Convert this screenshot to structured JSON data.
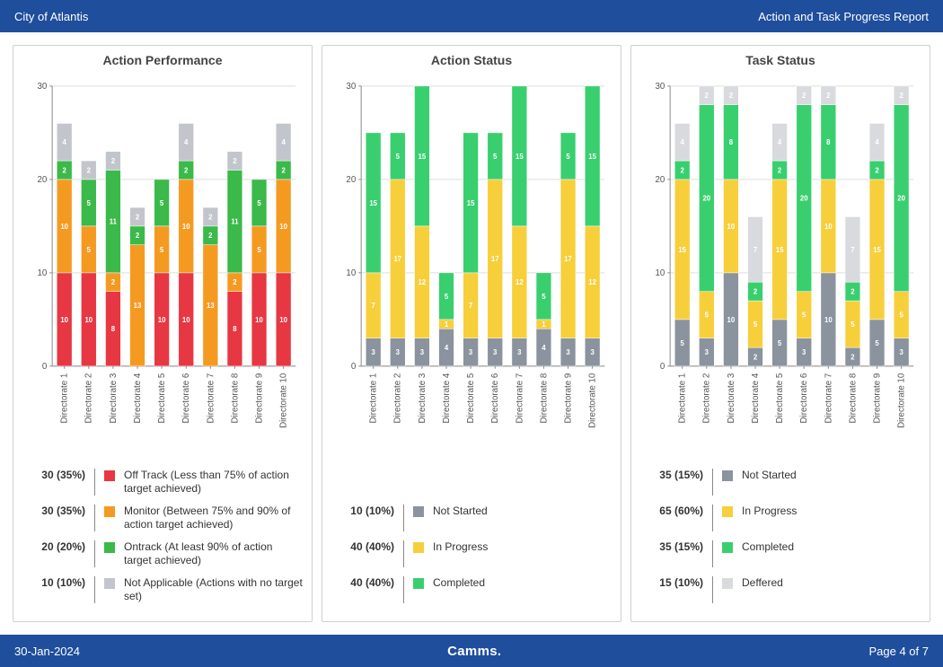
{
  "header": {
    "left": "City of Atlantis",
    "right": "Action and Task Progress Report"
  },
  "footer": {
    "date": "30-Jan-2024",
    "brand": "Camms.",
    "page": "Page 4 of 7"
  },
  "categories": [
    "Directorate 1",
    "Directorate 2",
    "Directorate 3",
    "Directorate 4",
    "Directorate 5",
    "Directorate 6",
    "Directorate 7",
    "Directorate 8",
    "Directorate 9",
    "Directorate 10"
  ],
  "yTicks": [
    0,
    10,
    20,
    30
  ],
  "charts": [
    {
      "title": "Action Performance",
      "series": [
        {
          "key": "off",
          "color": "#e73743",
          "values": [
            10,
            10,
            8,
            0,
            10,
            10,
            0,
            8,
            10,
            10
          ]
        },
        {
          "key": "mon",
          "color": "#f59a21",
          "values": [
            10,
            5,
            2,
            13,
            5,
            10,
            13,
            2,
            5,
            10
          ]
        },
        {
          "key": "on",
          "color": "#3bb94a",
          "values": [
            2,
            5,
            11,
            2,
            5,
            2,
            2,
            11,
            5,
            2
          ]
        },
        {
          "key": "na",
          "color": "#c2c6cc",
          "values": [
            4,
            2,
            2,
            2,
            0,
            4,
            2,
            2,
            0,
            4
          ]
        }
      ],
      "legend": [
        {
          "num": "30 (35%)",
          "color": "#e73743",
          "text": "Off Track (Less than 75% of action target achieved)"
        },
        {
          "num": "30 (35%)",
          "color": "#f59a21",
          "text": "Monitor (Between 75% and 90% of action target achieved)"
        },
        {
          "num": "20 (20%)",
          "color": "#3bb94a",
          "text": "Ontrack (At least 90% of action target achieved)"
        },
        {
          "num": "10 (10%)",
          "color": "#c2c6cc",
          "text": "Not Applicable (Actions with no target set)"
        }
      ]
    },
    {
      "title": "Action Status",
      "series": [
        {
          "key": "ns",
          "color": "#8a939e",
          "values": [
            3,
            3,
            3,
            4,
            3,
            3,
            3,
            4,
            3,
            3
          ]
        },
        {
          "key": "ip",
          "color": "#f6cf3b",
          "values": [
            7,
            17,
            12,
            1,
            7,
            17,
            12,
            1,
            17,
            12
          ]
        },
        {
          "key": "cmp",
          "color": "#39cf6f",
          "values": [
            15,
            5,
            15,
            5,
            15,
            5,
            15,
            5,
            5,
            15
          ]
        }
      ],
      "legend": [
        {
          "num": "10 (10%)",
          "color": "#8a939e",
          "text": "Not Started"
        },
        {
          "num": "40 (40%)",
          "color": "#f6cf3b",
          "text": "In Progress"
        },
        {
          "num": "40 (40%)",
          "color": "#39cf6f",
          "text": "Completed"
        }
      ]
    },
    {
      "title": "Task Status",
      "series": [
        {
          "key": "ns",
          "color": "#8a939e",
          "values": [
            5,
            3,
            10,
            2,
            5,
            3,
            10,
            2,
            5,
            3
          ]
        },
        {
          "key": "ip",
          "color": "#f6cf3b",
          "values": [
            15,
            5,
            10,
            5,
            15,
            5,
            10,
            5,
            15,
            5
          ]
        },
        {
          "key": "cmp",
          "color": "#39cf6f",
          "values": [
            2,
            20,
            8,
            2,
            2,
            20,
            8,
            2,
            2,
            20
          ]
        },
        {
          "key": "def",
          "color": "#d8dade",
          "values": [
            4,
            2,
            2,
            7,
            4,
            2,
            2,
            7,
            4,
            2
          ]
        }
      ],
      "legend": [
        {
          "num": "35 (15%)",
          "color": "#8a939e",
          "text": "Not Started"
        },
        {
          "num": "65 (60%)",
          "color": "#f6cf3b",
          "text": "In Progress"
        },
        {
          "num": "35 (15%)",
          "color": "#39cf6f",
          "text": "Completed"
        },
        {
          "num": "15 (10%)",
          "color": "#d8dade",
          "text": "Deffered"
        }
      ]
    }
  ],
  "chart_data": {
    "type": "bar",
    "stacked": true,
    "categories": [
      "Directorate 1",
      "Directorate 2",
      "Directorate 3",
      "Directorate 4",
      "Directorate 5",
      "Directorate 6",
      "Directorate 7",
      "Directorate 8",
      "Directorate 9",
      "Directorate 10"
    ],
    "ylim": [
      0,
      30
    ],
    "charts": [
      {
        "title": "Action Performance",
        "series": [
          {
            "name": "Off Track",
            "values": [
              10,
              10,
              8,
              0,
              10,
              10,
              0,
              8,
              10,
              10
            ]
          },
          {
            "name": "Monitor",
            "values": [
              10,
              5,
              2,
              13,
              5,
              10,
              13,
              2,
              5,
              10
            ]
          },
          {
            "name": "Ontrack",
            "values": [
              2,
              5,
              11,
              2,
              5,
              2,
              2,
              11,
              5,
              2
            ]
          },
          {
            "name": "Not Applicable",
            "values": [
              4,
              2,
              2,
              2,
              0,
              4,
              2,
              2,
              0,
              4
            ]
          }
        ]
      },
      {
        "title": "Action Status",
        "series": [
          {
            "name": "Not Started",
            "values": [
              3,
              3,
              3,
              4,
              3,
              3,
              3,
              4,
              3,
              3
            ]
          },
          {
            "name": "In Progress",
            "values": [
              7,
              17,
              12,
              1,
              7,
              17,
              12,
              1,
              17,
              12
            ]
          },
          {
            "name": "Completed",
            "values": [
              15,
              5,
              15,
              5,
              15,
              5,
              15,
              5,
              5,
              15
            ]
          }
        ]
      },
      {
        "title": "Task Status",
        "series": [
          {
            "name": "Not Started",
            "values": [
              5,
              3,
              10,
              2,
              5,
              3,
              10,
              2,
              5,
              3
            ]
          },
          {
            "name": "In Progress",
            "values": [
              15,
              5,
              10,
              5,
              15,
              5,
              10,
              5,
              15,
              5
            ]
          },
          {
            "name": "Completed",
            "values": [
              2,
              20,
              8,
              2,
              2,
              20,
              8,
              2,
              2,
              20
            ]
          },
          {
            "name": "Deffered",
            "values": [
              4,
              2,
              2,
              7,
              4,
              2,
              2,
              7,
              4,
              2
            ]
          }
        ]
      }
    ]
  }
}
